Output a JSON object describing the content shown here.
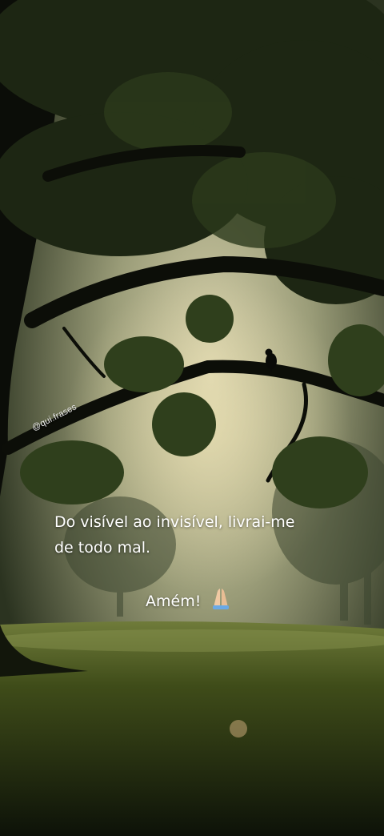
{
  "watermark": "@qui.frases",
  "quote": {
    "line1": "Do visível ao invisível, livrai-me",
    "line2": "de todo mal.",
    "closing": "Amém!"
  },
  "icons": {
    "closing_emoji": "praying-hands-icon"
  },
  "colors": {
    "text": "#ffffff",
    "sky": "#c9c7a6",
    "foliage": "#1f2a14",
    "grass": "#4a5a1e"
  }
}
